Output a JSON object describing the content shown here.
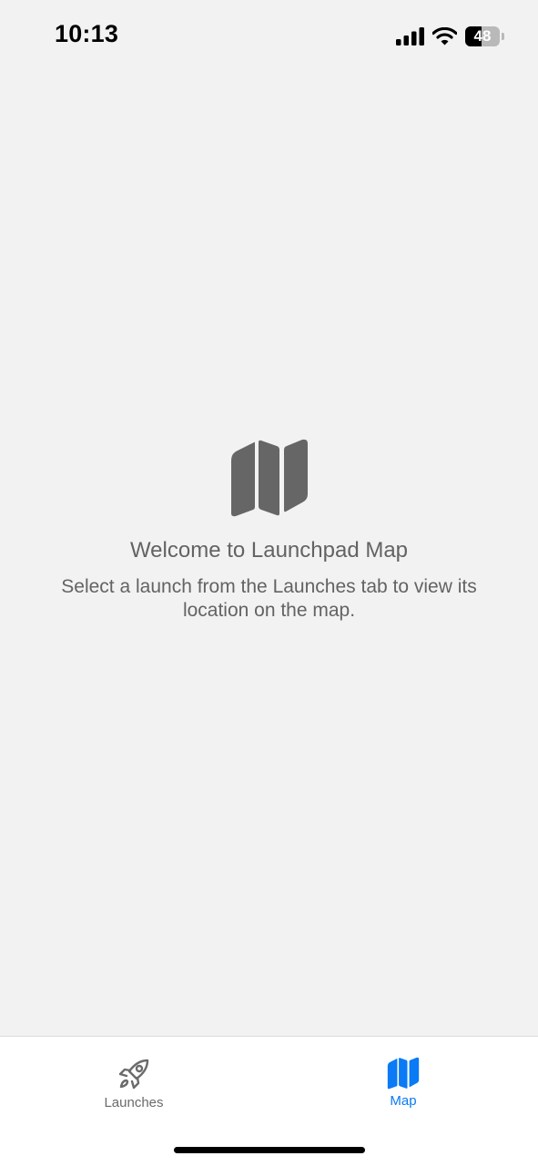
{
  "status_bar": {
    "time": "10:13",
    "battery_level": "48",
    "icons": [
      "cellular-signal-icon",
      "wifi-icon",
      "battery-icon"
    ]
  },
  "welcome": {
    "icon": "map-icon",
    "title": "Welcome to Launchpad Map",
    "message": "Select a launch from the Launches tab to view its location on the map."
  },
  "tab_bar": {
    "tabs": [
      {
        "label": "Launches",
        "icon": "rocket-icon",
        "selected": false
      },
      {
        "label": "Map",
        "icon": "map-icon",
        "selected": true
      }
    ],
    "active_color": "#0A7AF5",
    "inactive_color": "#6B6B6B"
  }
}
